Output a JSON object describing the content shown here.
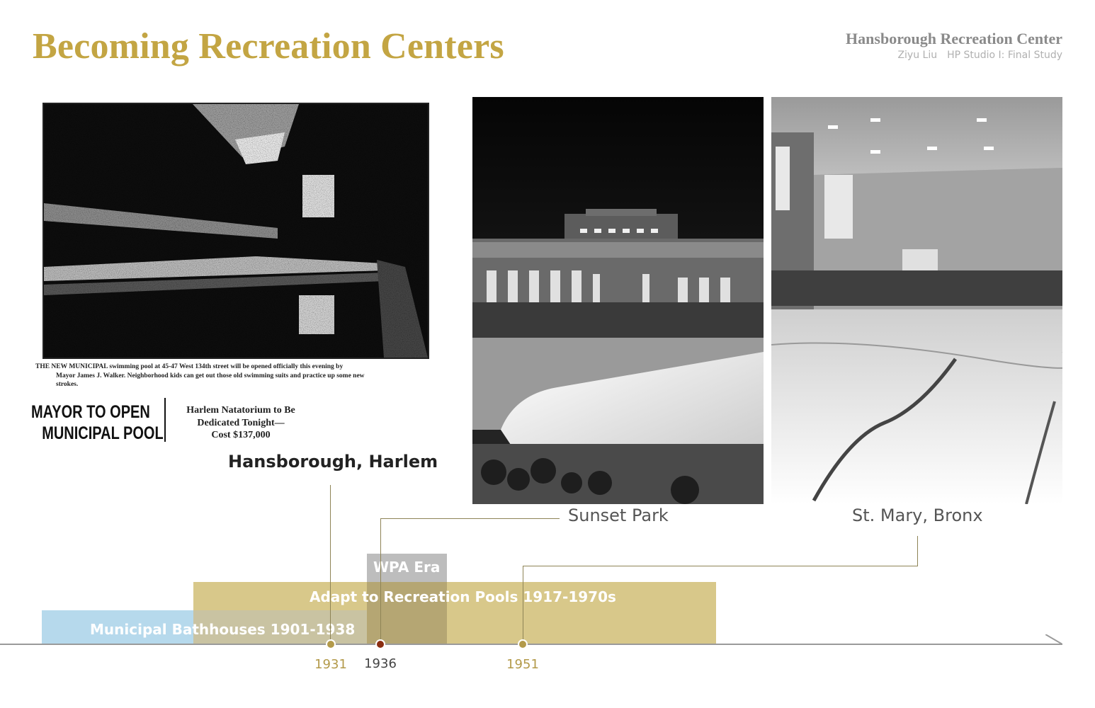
{
  "header": {
    "title": "Becoming Recreation Centers",
    "project_name": "Hansborough Recreation Center",
    "author": "Ziyu Liu",
    "course": "HP Studio I: Final Study"
  },
  "clipping": {
    "caption_lines": [
      "THE NEW MUNICIPAL swimming pool at 45-47 West 134th street will be opened officially this evening by",
      "Mayor James J. Walker. Neighborhood kids can get out those old swimming suits and practice up some new",
      "strokes."
    ],
    "headline_lines": [
      "MAYOR TO OPEN",
      "MUNICIPAL POOL"
    ],
    "subhead_lines": [
      "Harlem Natatorium to Be",
      "Dedicated Tonight—",
      "Cost $137,000"
    ]
  },
  "photos": {
    "harlem_label": "Hansborough, Harlem",
    "sunset_label": "Sunset Park",
    "stmary_label": "St. Mary, Bronx"
  },
  "timeline": {
    "bands": {
      "wpa": "WPA Era",
      "adapt": "Adapt to Recreation Pools 1917-1970s",
      "municipal": "Municipal  Bathhouses 1901-1938"
    },
    "years": {
      "y1931": "1931",
      "y1936": "1936",
      "y1951": "1951"
    }
  },
  "colors": {
    "title_gold": "#C3A543",
    "municipal_blue": "#B6D9EC",
    "adapt_gold": "#D8C88A",
    "wpa_grey": "#BDBDBD",
    "year_gold": "#B39A4A",
    "dot_1936": "#8B2E12"
  }
}
